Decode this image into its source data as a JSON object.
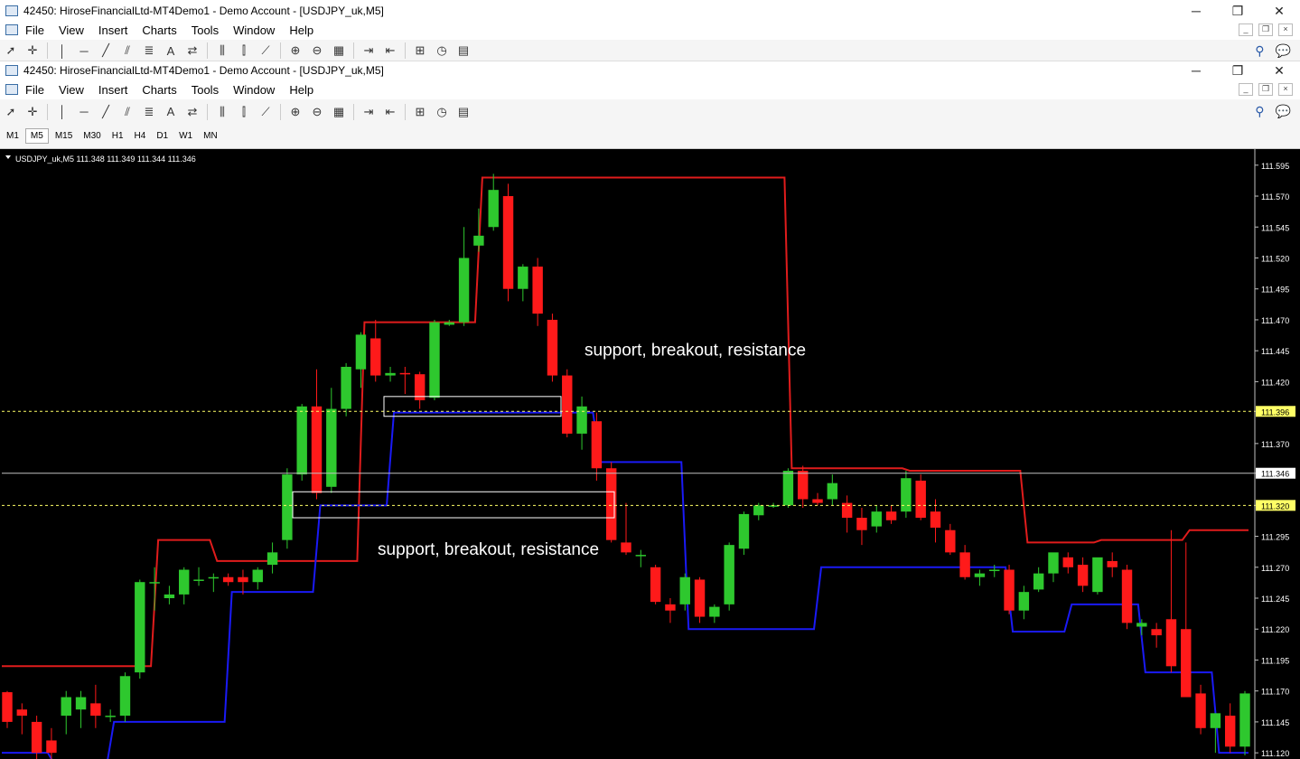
{
  "outer_window": {
    "title": "42450: HiroseFinancialLtd-MT4Demo1 - Demo Account - [USDJPY_uk,M5]",
    "menu": [
      "File",
      "View",
      "Insert",
      "Charts",
      "Tools",
      "Window",
      "Help"
    ]
  },
  "inner_window": {
    "title": "42450: HiroseFinancialLtd-MT4Demo1 - Demo Account - [USDJPY_uk,M5]",
    "menu": [
      "File",
      "View",
      "Insert",
      "Charts",
      "Tools",
      "Window",
      "Help"
    ]
  },
  "timeframes": {
    "items": [
      "M1",
      "M5",
      "M15",
      "M30",
      "H1",
      "H4",
      "D1",
      "W1",
      "MN"
    ],
    "active": "M5"
  },
  "colors": {
    "background": "#000000",
    "bull": "#2ec82e",
    "bear": "#ff1a1a",
    "upper_channel": "#e01c1c",
    "lower_channel": "#1a1af5",
    "grid": "#808080",
    "ask_label": "#ffff66"
  },
  "chart_data": {
    "type": "candlestick",
    "symbol_header": "USDJPY_uk,M5  111.348 111.349 111.344 111.346",
    "annotations": [
      "support, breakout, resistance",
      "support, breakout, resistance"
    ],
    "price_labels": [
      "111.595",
      "111.570",
      "111.545",
      "111.520",
      "111.495",
      "111.470",
      "111.445",
      "111.420",
      "111.396",
      "111.370",
      "111.346",
      "111.320",
      "111.295",
      "111.270",
      "111.245",
      "111.220",
      "111.195",
      "111.170",
      "111.145",
      "111.120"
    ],
    "highlighted_prices": {
      "upper_level": "111.396",
      "current": "111.346",
      "lower_level": "111.320"
    },
    "ylim": [
      111.115,
      111.608
    ],
    "candles": [
      [
        111.169,
        111.17,
        111.14,
        111.145
      ],
      [
        111.155,
        111.16,
        111.135,
        111.15
      ],
      [
        111.145,
        111.15,
        111.105,
        111.12
      ],
      [
        111.13,
        111.14,
        111.11,
        111.12
      ],
      [
        111.15,
        111.17,
        111.135,
        111.165
      ],
      [
        111.155,
        111.17,
        111.14,
        111.165
      ],
      [
        111.16,
        111.175,
        111.14,
        111.15
      ],
      [
        111.15,
        111.155,
        111.145,
        111.15
      ],
      [
        111.15,
        111.185,
        111.145,
        111.182
      ],
      [
        111.185,
        111.26,
        111.18,
        111.258
      ],
      [
        111.258,
        111.27,
        111.235,
        111.258
      ],
      [
        111.245,
        111.255,
        111.24,
        111.248
      ],
      [
        111.248,
        111.27,
        111.24,
        111.268
      ],
      [
        111.26,
        111.27,
        111.255,
        111.26
      ],
      [
        111.262,
        111.265,
        111.25,
        111.262
      ],
      [
        111.262,
        111.265,
        111.255,
        111.258
      ],
      [
        111.262,
        111.268,
        111.248,
        111.258
      ],
      [
        111.258,
        111.27,
        111.252,
        111.268
      ],
      [
        111.272,
        111.29,
        111.265,
        111.282
      ],
      [
        111.292,
        111.35,
        111.285,
        111.345
      ],
      [
        111.345,
        111.402,
        111.34,
        111.4
      ],
      [
        111.4,
        111.43,
        111.325,
        111.33
      ],
      [
        111.335,
        111.415,
        111.33,
        111.398
      ],
      [
        111.398,
        111.435,
        111.392,
        111.432
      ],
      [
        111.43,
        111.46,
        111.415,
        111.458
      ],
      [
        111.455,
        111.47,
        111.42,
        111.425
      ],
      [
        111.425,
        111.432,
        111.42,
        111.427
      ],
      [
        111.427,
        111.432,
        111.41,
        111.426
      ],
      [
        111.426,
        111.428,
        111.398,
        111.405
      ],
      [
        111.407,
        111.47,
        111.405,
        111.468
      ],
      [
        111.466,
        111.47,
        111.465,
        111.468
      ],
      [
        111.468,
        111.545,
        111.465,
        111.52
      ],
      [
        111.53,
        111.56,
        111.525,
        111.538
      ],
      [
        111.545,
        111.588,
        111.542,
        111.575
      ],
      [
        111.57,
        111.58,
        111.485,
        111.495
      ],
      [
        111.495,
        111.515,
        111.485,
        111.513
      ],
      [
        111.513,
        111.52,
        111.465,
        111.475
      ],
      [
        111.47,
        111.475,
        111.42,
        111.425
      ],
      [
        111.425,
        111.43,
        111.375,
        111.378
      ],
      [
        111.378,
        111.408,
        111.365,
        111.4
      ],
      [
        111.388,
        111.395,
        111.34,
        111.35
      ],
      [
        111.35,
        111.355,
        111.29,
        111.292
      ],
      [
        111.29,
        111.322,
        111.28,
        111.282
      ],
      [
        111.28,
        111.284,
        111.27,
        111.28
      ],
      [
        111.27,
        111.272,
        111.24,
        111.242
      ],
      [
        111.24,
        111.245,
        111.225,
        111.235
      ],
      [
        111.24,
        111.265,
        111.235,
        111.262
      ],
      [
        111.26,
        111.262,
        111.225,
        111.23
      ],
      [
        111.23,
        111.24,
        111.225,
        111.238
      ],
      [
        111.24,
        111.29,
        111.235,
        111.288
      ],
      [
        111.285,
        111.315,
        111.28,
        111.313
      ],
      [
        111.312,
        111.322,
        111.308,
        111.32
      ],
      [
        111.32,
        111.322,
        111.318,
        111.32
      ],
      [
        111.32,
        111.35,
        111.318,
        111.348
      ],
      [
        111.348,
        111.352,
        111.318,
        111.325
      ],
      [
        111.325,
        111.33,
        111.32,
        111.322
      ],
      [
        111.325,
        111.345,
        111.32,
        111.338
      ],
      [
        111.322,
        111.328,
        111.298,
        111.31
      ],
      [
        111.31,
        111.318,
        111.288,
        111.3
      ],
      [
        111.303,
        111.32,
        111.298,
        111.315
      ],
      [
        111.315,
        111.32,
        111.305,
        111.308
      ],
      [
        111.315,
        111.348,
        111.31,
        111.342
      ],
      [
        111.34,
        111.345,
        111.308,
        111.31
      ],
      [
        111.315,
        111.325,
        111.29,
        111.302
      ],
      [
        111.3,
        111.305,
        111.28,
        111.282
      ],
      [
        111.282,
        111.288,
        111.26,
        111.262
      ],
      [
        111.262,
        111.268,
        111.255,
        111.265
      ],
      [
        111.268,
        111.272,
        111.262,
        111.268
      ],
      [
        111.268,
        111.272,
        111.232,
        111.235
      ],
      [
        111.235,
        111.255,
        111.228,
        111.25
      ],
      [
        111.252,
        111.27,
        111.25,
        111.265
      ],
      [
        111.265,
        111.28,
        111.258,
        111.282
      ],
      [
        111.278,
        111.282,
        111.265,
        111.27
      ],
      [
        111.272,
        111.278,
        111.25,
        111.255
      ],
      [
        111.25,
        111.275,
        111.248,
        111.278
      ],
      [
        111.275,
        111.282,
        111.262,
        111.27
      ],
      [
        111.268,
        111.272,
        111.22,
        111.225
      ],
      [
        111.222,
        111.228,
        111.215,
        111.225
      ],
      [
        111.22,
        111.225,
        111.205,
        111.215
      ],
      [
        111.228,
        111.3,
        111.185,
        111.19
      ],
      [
        111.22,
        111.29,
        111.18,
        111.165
      ],
      [
        111.168,
        111.175,
        111.135,
        111.14
      ],
      [
        111.14,
        111.15,
        111.12,
        111.152
      ],
      [
        111.15,
        111.16,
        111.12,
        111.125
      ],
      [
        111.125,
        111.17,
        111.118,
        111.168
      ]
    ],
    "upper_channel": [
      111.19,
      111.19,
      111.19,
      111.19,
      111.19,
      111.19,
      111.19,
      111.19,
      111.19,
      111.19,
      111.292,
      111.292,
      111.292,
      111.292,
      111.275,
      111.275,
      111.275,
      111.275,
      111.275,
      111.275,
      111.275,
      111.275,
      111.275,
      111.275,
      111.468,
      111.468,
      111.468,
      111.468,
      111.468,
      111.468,
      111.468,
      111.468,
      111.585,
      111.585,
      111.585,
      111.585,
      111.585,
      111.585,
      111.585,
      111.585,
      111.585,
      111.585,
      111.585,
      111.585,
      111.585,
      111.585,
      111.585,
      111.585,
      111.585,
      111.585,
      111.585,
      111.585,
      111.585,
      111.35,
      111.35,
      111.35,
      111.35,
      111.35,
      111.35,
      111.35,
      111.35,
      111.348,
      111.348,
      111.348,
      111.348,
      111.348,
      111.348,
      111.348,
      111.348,
      111.29,
      111.29,
      111.29,
      111.29,
      111.29,
      111.292,
      111.292,
      111.292,
      111.292,
      111.292,
      111.292,
      111.3,
      111.3,
      111.3,
      111.3,
      111.3
    ],
    "lower_channel": [
      111.12,
      111.12,
      111.12,
      111.11,
      111.11,
      111.11,
      111.11,
      111.145,
      111.145,
      111.145,
      111.145,
      111.145,
      111.145,
      111.145,
      111.145,
      111.25,
      111.25,
      111.25,
      111.25,
      111.25,
      111.25,
      111.32,
      111.32,
      111.32,
      111.32,
      111.32,
      111.395,
      111.395,
      111.395,
      111.395,
      111.395,
      111.395,
      111.395,
      111.395,
      111.395,
      111.395,
      111.395,
      111.395,
      111.395,
      111.395,
      111.355,
      111.355,
      111.355,
      111.355,
      111.355,
      111.355,
      111.22,
      111.22,
      111.22,
      111.22,
      111.22,
      111.22,
      111.22,
      111.22,
      111.22,
      111.27,
      111.27,
      111.27,
      111.27,
      111.27,
      111.27,
      111.27,
      111.27,
      111.27,
      111.27,
      111.27,
      111.27,
      111.27,
      111.218,
      111.218,
      111.218,
      111.218,
      111.24,
      111.24,
      111.24,
      111.24,
      111.24,
      111.185,
      111.185,
      111.185,
      111.185,
      111.185,
      111.12,
      111.12,
      111.12
    ]
  }
}
